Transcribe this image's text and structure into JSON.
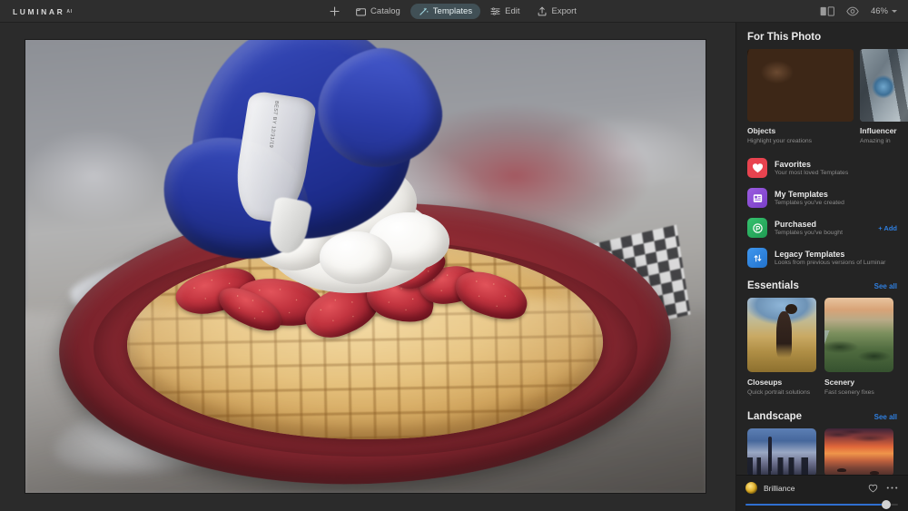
{
  "app": {
    "brand": "LUMINAR",
    "brand_superscript": "AI"
  },
  "toolbar": {
    "add_label": "",
    "items": [
      {
        "label": "Catalog",
        "icon": "folder-icon",
        "active": false
      },
      {
        "label": "Templates",
        "icon": "wand-icon",
        "active": true
      },
      {
        "label": "Edit",
        "icon": "sliders-icon",
        "active": false
      },
      {
        "label": "Export",
        "icon": "upload-icon",
        "active": false
      }
    ],
    "compare_icon": "before-after-icon",
    "preview_icon": "eye-icon",
    "zoom_level": "46%"
  },
  "canvas": {
    "photo_alt": "Gloved hand piping whipped cream onto a strawberry waffle on a red plate",
    "bag_label": "BEST BY 12/31/19"
  },
  "panel": {
    "for_this_photo": {
      "title": "For This Photo",
      "cards": [
        {
          "name": "Objects",
          "subtitle": "Highlight your creations",
          "thumb": "coffee-beans-thumb"
        },
        {
          "name": "Influencer",
          "subtitle": "Amazing in",
          "thumb": "influencer-thumb"
        }
      ]
    },
    "categories": [
      {
        "name": "Favorites",
        "subtitle": "Your most loved Templates",
        "icon": "heart-icon",
        "color": "#e8434f",
        "action": null
      },
      {
        "name": "My Templates",
        "subtitle": "Templates you've created",
        "icon": "document-icon",
        "color": "#8b4fd8",
        "action": null
      },
      {
        "name": "Purchased",
        "subtitle": "Templates you've bought",
        "icon": "tag-icon",
        "color": "#27ae60",
        "action": "+ Add"
      },
      {
        "name": "Legacy Templates",
        "subtitle": "Looks from previous versions of Luminar",
        "icon": "sliders-square-icon",
        "color": "#2f86e0",
        "action": null
      }
    ],
    "sections": [
      {
        "title": "Essentials",
        "see_all": "See all",
        "cards": [
          {
            "name": "Closeups",
            "subtitle": "Quick portrait solutions",
            "thumb": "closeup-thumb"
          },
          {
            "name": "Scenery",
            "subtitle": "Fast scenery fixes",
            "thumb": "scenery-thumb"
          }
        ]
      },
      {
        "title": "Landscape",
        "see_all": "See all",
        "cards": [
          {
            "name": "",
            "subtitle": "",
            "thumb": "city-skyline-thumb"
          },
          {
            "name": "",
            "subtitle": "",
            "thumb": "sunset-boats-thumb"
          }
        ]
      }
    ]
  },
  "adjust": {
    "name": "Brilliance",
    "favorite_icon": "heart-outline-icon",
    "more_icon": "ellipsis-icon",
    "slider_percent": 92,
    "accent_color": "#2f6fd0"
  }
}
